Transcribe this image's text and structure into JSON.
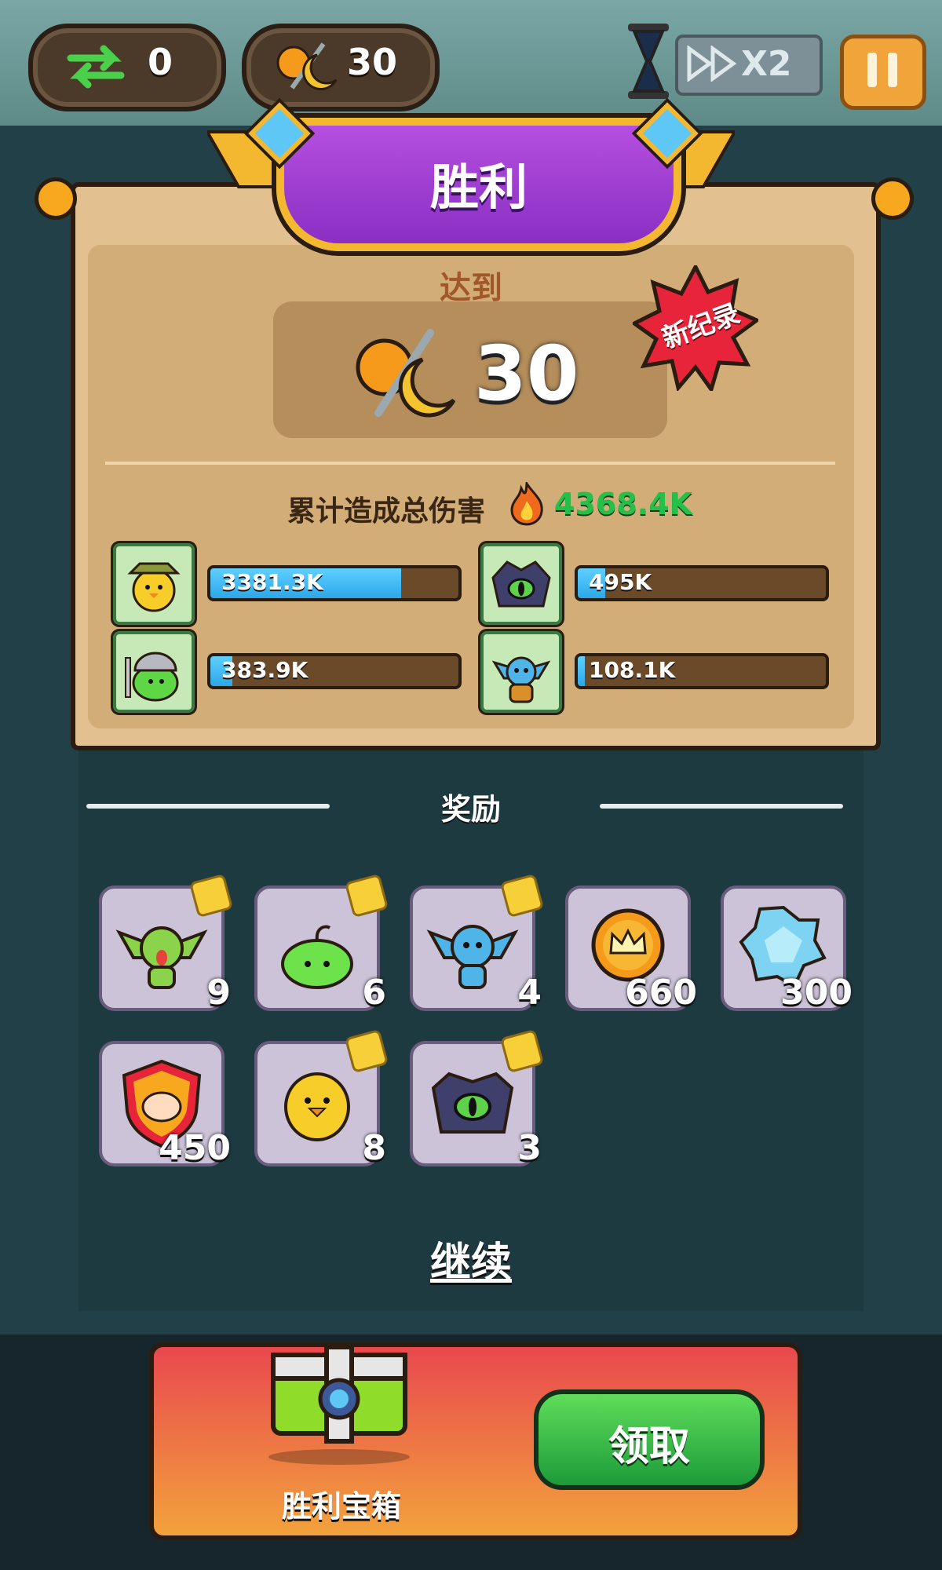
{
  "hud": {
    "swap_count": "0",
    "wave_count": "30",
    "speed_label": "X2"
  },
  "panel": {
    "title": "胜利",
    "reach_label": "达到",
    "score": "30",
    "new_record": "新纪录",
    "damage_label": "累计造成总伤害",
    "damage_total": "4368.4K",
    "heroes": [
      {
        "icon": "yellow-duck-ranger-icon",
        "damage": "3381.3K",
        "fill": 0.77
      },
      {
        "icon": "dark-eye-demon-icon",
        "damage": "495K",
        "fill": 0.11
      },
      {
        "icon": "green-slime-viking-icon",
        "damage": "383.9K",
        "fill": 0.09
      },
      {
        "icon": "blue-goblin-mage-icon",
        "damage": "108.1K",
        "fill": 0.03
      }
    ]
  },
  "rewards": {
    "title": "奖励",
    "items": [
      {
        "icon": "green-goblin-icon",
        "qty": "9",
        "puzzle": true
      },
      {
        "icon": "green-slime-icon",
        "qty": "6",
        "puzzle": true
      },
      {
        "icon": "blue-goblin-icon",
        "qty": "4",
        "puzzle": true
      },
      {
        "icon": "gold-crown-coin-icon",
        "qty": "660",
        "puzzle": false
      },
      {
        "icon": "blue-gem-icon",
        "qty": "300",
        "puzzle": false
      },
      {
        "icon": "red-shield-badge-icon",
        "qty": "450",
        "puzzle": false
      },
      {
        "icon": "yellow-chick-icon",
        "qty": "8",
        "puzzle": true
      },
      {
        "icon": "dark-eye-demon-icon",
        "qty": "3",
        "puzzle": true
      }
    ]
  },
  "continue_label": "继续",
  "chest": {
    "label": "胜利宝箱",
    "claim_label": "领取"
  },
  "colors": {
    "banner_purple": "#9b3fd1",
    "damage_green": "#24c04a",
    "claim_green": "#3cbf4a",
    "panel_tan": "#e2c08f"
  }
}
